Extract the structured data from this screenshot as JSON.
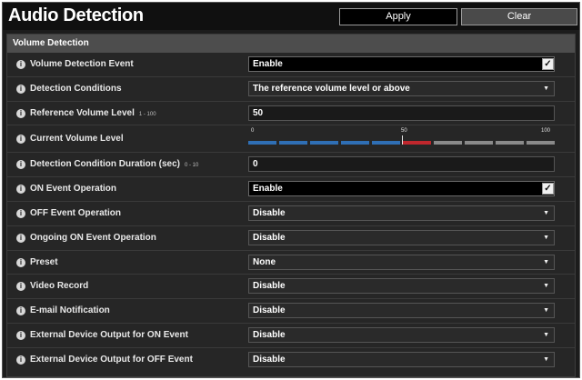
{
  "header": {
    "title": "Audio Detection",
    "apply_label": "Apply",
    "clear_label": "Clear"
  },
  "section": {
    "title": "Volume Detection"
  },
  "rows": [
    {
      "label": "Volume Detection Event",
      "value": "Enable",
      "kind": "checkbox"
    },
    {
      "label": "Detection Conditions",
      "value": "The reference volume level or above",
      "kind": "select"
    },
    {
      "label": "Reference Volume Level",
      "range": "1 - 100",
      "value": "50",
      "kind": "text"
    },
    {
      "label": "Current Volume Level",
      "kind": "meter"
    },
    {
      "label": "Detection Condition Duration (sec)",
      "range": "0 - 10",
      "value": "0",
      "kind": "text"
    },
    {
      "label": "ON Event Operation",
      "value": "Enable",
      "kind": "checkbox"
    },
    {
      "label": "OFF Event Operation",
      "value": "Disable",
      "kind": "select"
    },
    {
      "label": "Ongoing ON Event Operation",
      "value": "Disable",
      "kind": "select"
    },
    {
      "label": "Preset",
      "value": "None",
      "kind": "select"
    },
    {
      "label": "Video Record",
      "value": "Disable",
      "kind": "select"
    },
    {
      "label": "E-mail Notification",
      "value": "Disable",
      "kind": "select"
    },
    {
      "label": "External Device Output for ON Event",
      "value": "Disable",
      "kind": "select"
    },
    {
      "label": "External Device Output for OFF Event",
      "value": "Disable",
      "kind": "select"
    }
  ],
  "meter": {
    "min_label": "0",
    "mid_label": "50",
    "max_label": "100",
    "reference_level": 50,
    "current_level": 60,
    "colors": {
      "below": "#2f6fb5",
      "above": "#c0272d",
      "idle": "#8a8a8a"
    }
  },
  "icons": {
    "info": "info-icon",
    "checkbox": "checkmark-icon",
    "dropdown": "chevron-down-icon"
  }
}
